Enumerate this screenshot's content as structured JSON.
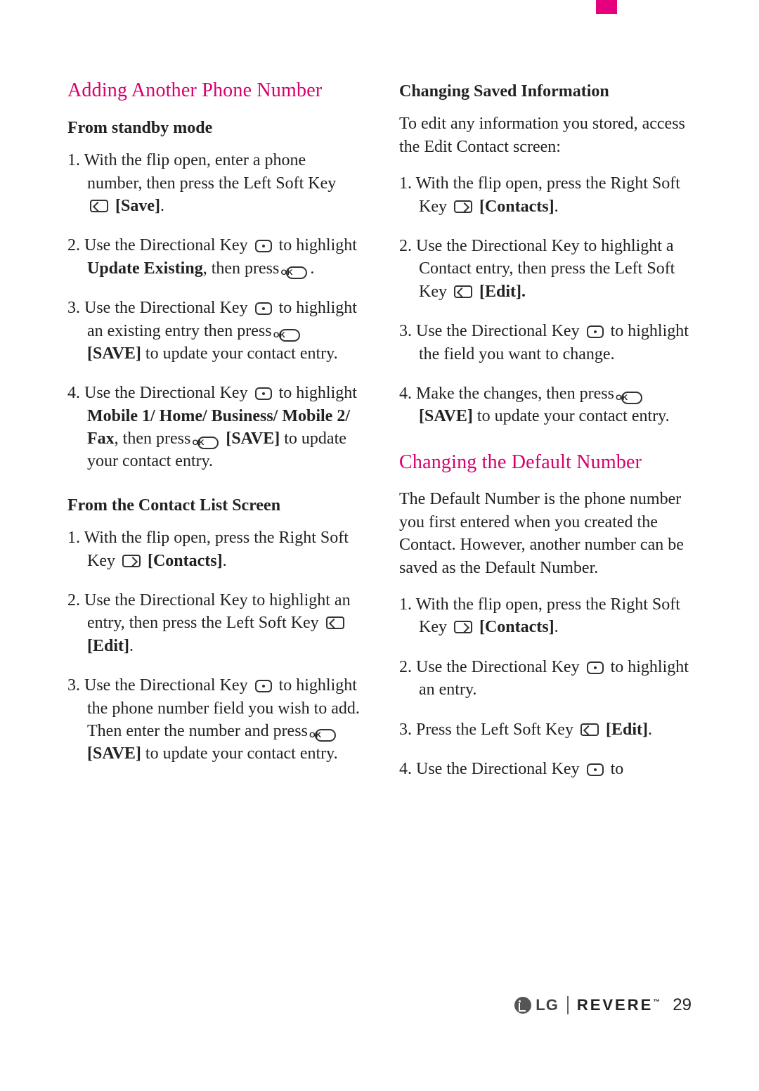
{
  "left": {
    "heading": "Adding Another Phone Number",
    "sub1": "From standby mode",
    "s1_1a": "1. With the flip open, enter a phone number, then press the Left Soft Key ",
    "s1_1b": " ",
    "s1_1c": "[Save]",
    "s1_1d": ".",
    "s1_2a": "2. Use the Directional Key ",
    "s1_2b": " to highlight ",
    "s1_2c": "Update Existing",
    "s1_2d": ", then press ",
    "s1_2e": ".",
    "s1_3a": "3. Use the Directional Key ",
    "s1_3b": " to highlight an existing entry then press ",
    "s1_3c": " ",
    "s1_3d": "[SAVE]",
    "s1_3e": " to update your contact entry.",
    "s1_4a": "4. Use the Directional Key ",
    "s1_4b": " to highlight ",
    "s1_4c": "Mobile 1/ Home/ Business/ Mobile 2/ Fax",
    "s1_4d": ", then press ",
    "s1_4e": " ",
    "s1_4f": "[SAVE]",
    "s1_4g": " to update your contact entry.",
    "sub2": "From the Contact List Screen",
    "s2_1a": "1. With the flip open, press the Right Soft Key ",
    "s2_1b": " ",
    "s2_1c": "[Contacts]",
    "s2_1d": ".",
    "s2_2a": "2. Use the Directional Key  to highlight an entry, then press the Left Soft Key ",
    "s2_2b": " ",
    "s2_2c": "[Edit]",
    "s2_2d": ".",
    "s2_3a": "3. Use the Directional Key ",
    "s2_3b": " to highlight the phone number field you wish to add. Then enter the number and press ",
    "s2_3c": " ",
    "s2_3d": "[SAVE]",
    "s2_3e": " to update your contact entry."
  },
  "right": {
    "sub1": "Changing Saved Information",
    "intro": "To edit any information you stored, access the Edit Contact screen:",
    "c1a": "1. With the flip open, press the Right Soft Key ",
    "c1b": " ",
    "c1c": "[Contacts]",
    "c1d": ".",
    "c2a": "2. Use the Directional Key  to highlight a Contact entry, then press the Left Soft Key ",
    "c2b": " ",
    "c2c": "[Edit].",
    "c3a": "3. Use the Directional Key ",
    "c3b": " to highlight the field you want to change.",
    "c4a": "4. Make the changes, then press ",
    "c4b": " ",
    "c4c": "[SAVE]",
    "c4d": " to update your contact entry.",
    "heading2": "Changing the Default Number",
    "intro2": "The Default Number is the phone number you first entered when you created the Contact. However, another number can be saved as the Default Number.",
    "d1a": "1. With the flip open, press the Right Soft Key ",
    "d1b": " ",
    "d1c": "[Contacts]",
    "d1d": ".",
    "d2a": "2. Use the Directional Key ",
    "d2b": " to highlight an entry.",
    "d3a": "3. Press the Left Soft Key ",
    "d3b": " ",
    "d3c": "[Edit]",
    "d3d": ".",
    "d4a": "4. Use the Directional Key ",
    "d4b": " to"
  },
  "ok_label": "OK",
  "footer": {
    "brand": "LG",
    "product": "REVERE",
    "tm": "™",
    "page": "29"
  }
}
